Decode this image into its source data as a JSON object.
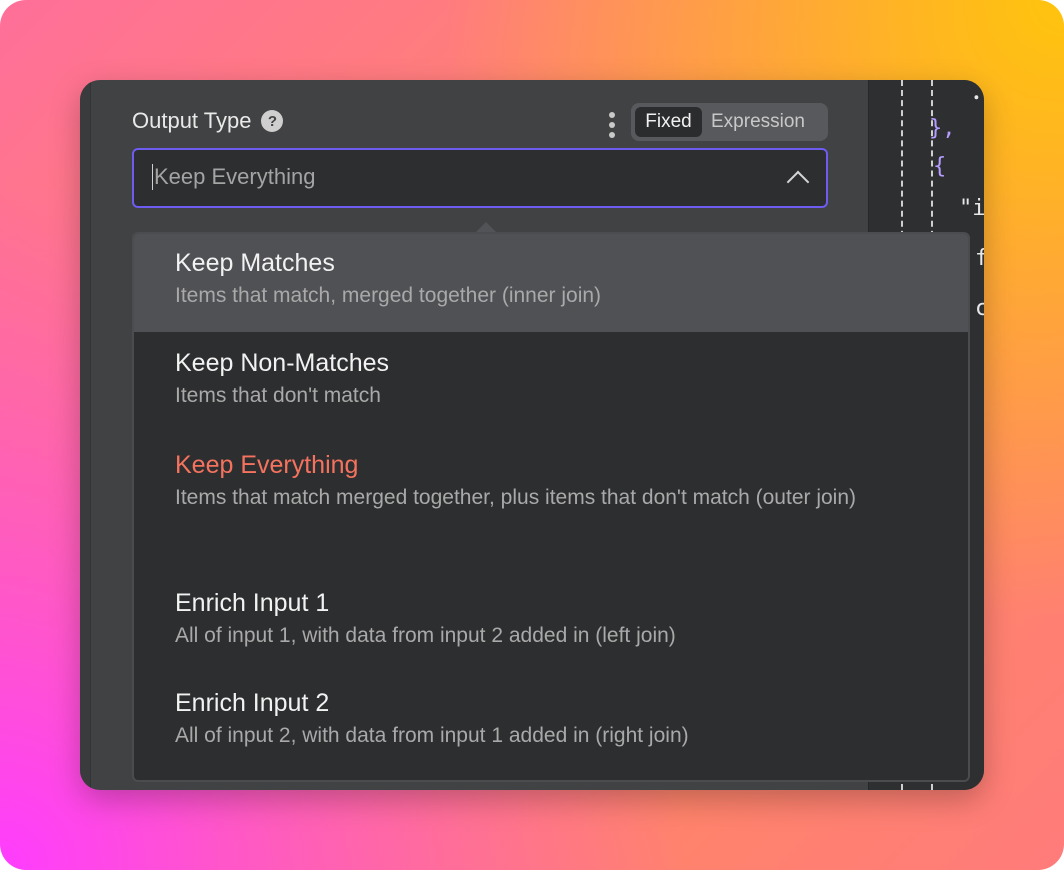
{
  "field": {
    "label": "Output Type",
    "help_icon": "question-circle-icon",
    "options_icon": "vertical-dots-icon",
    "toggle": {
      "fixed": "Fixed",
      "expression": "Expression"
    },
    "select_value": "Keep Everything",
    "chevron_icon": "chevron-up-icon"
  },
  "dropdown": {
    "options": [
      {
        "title": "Keep Matches",
        "description": "Items that match, merged together (inner join)"
      },
      {
        "title": "Keep Non-Matches",
        "description": "Items that don't match"
      },
      {
        "title": "Keep Everything",
        "description": "Items that match merged together, plus items that don't match (outer join)"
      },
      {
        "title": "Enrich Input 1",
        "description": "All of input 1, with data from input 2 added in (left join)"
      },
      {
        "title": "Enrich Input 2",
        "description": "All of input 2, with data from input 1 added in (right join)"
      }
    ]
  },
  "code": {
    "lines": [
      "},",
      "{",
      "\"i",
      "f",
      "c"
    ]
  },
  "colors": {
    "selected": "#f5735e",
    "focus_border": "#6e5cf0",
    "hover": "#505154"
  }
}
